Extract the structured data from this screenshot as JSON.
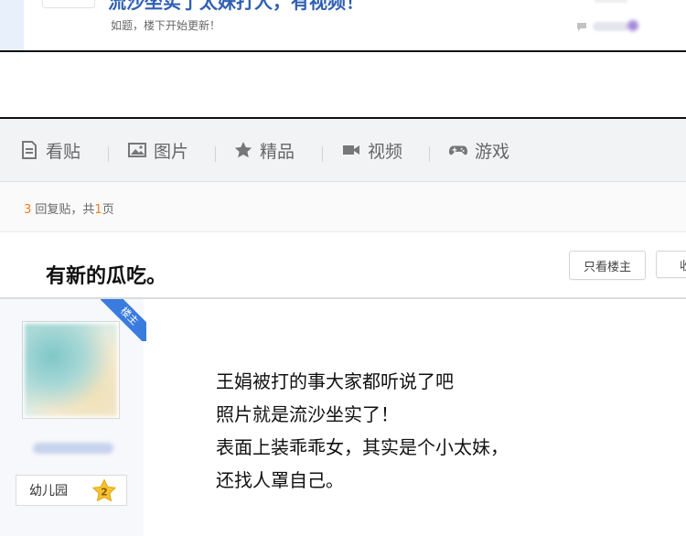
{
  "previous_thread": {
    "title_fragment": "流沙坐实了太妹打人，有视频！",
    "description": "如题，楼下开始更新！"
  },
  "nav": {
    "items": [
      {
        "label": "看贴",
        "icon": "document-icon"
      },
      {
        "label": "图片",
        "icon": "image-icon"
      },
      {
        "label": "精品",
        "icon": "star-icon"
      },
      {
        "label": "视频",
        "icon": "video-camera-icon"
      },
      {
        "label": "游戏",
        "icon": "gamepad-icon"
      }
    ]
  },
  "reply_info": {
    "count": "3",
    "text_mid": " 回复贴，共",
    "pages": "1",
    "text_end": "页"
  },
  "thread": {
    "title": "有新的瓜吃。",
    "only_op_button": "只看楼主",
    "collect_button_fragment": "收"
  },
  "post": {
    "op_badge": "楼主",
    "level_name": "幼儿园",
    "level_number": "2",
    "content_lines": [
      "王娟被打的事大家都听说了吧",
      "照片就是流沙坐实了！",
      "表面上装乖乖女，其实是个小太妹，",
      "还找人罩自己。"
    ]
  },
  "colors": {
    "accent_blue": "#3a7be0",
    "number_orange": "#f37b1d",
    "nav_background": "#f2f3f5"
  }
}
